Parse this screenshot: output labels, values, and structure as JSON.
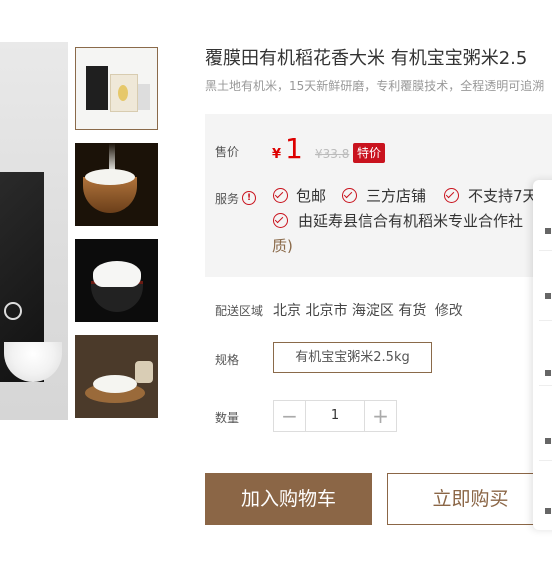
{
  "product": {
    "title": "覆膜田有机稻花香大米 有机宝宝粥米2.5",
    "subtitle": "黑土地有机米，15天新鲜研磨，专利覆膜技术，全程透明可追溯"
  },
  "price": {
    "label": "售价",
    "currency": "¥",
    "value": "1",
    "original": "¥33.8",
    "badge": "特价",
    "badge_color": "#c9131e"
  },
  "service": {
    "label": "服务",
    "info_icon": "!",
    "items": [
      "包邮",
      "三方店铺",
      "不支持7天",
      "由延寿县信合有机稻米专业合作社"
    ],
    "continuation": "质)"
  },
  "delivery": {
    "label": "配送区域",
    "location": "北京 北京市 海淀区",
    "stock": "有货",
    "modify": "修改"
  },
  "spec": {
    "label": "规格",
    "selected": "有机宝宝粥米2.5kg"
  },
  "quantity": {
    "label": "数量",
    "minus": "−",
    "value": "1",
    "plus": "+"
  },
  "actions": {
    "add_to_cart": "加入购物车",
    "buy_now": "立即购买",
    "accent_color": "#8b6646"
  },
  "thumbnails": [
    "thumbnail-package",
    "thumbnail-rice-spoon",
    "thumbnail-rice-bowl",
    "thumbnail-rice-plate"
  ]
}
